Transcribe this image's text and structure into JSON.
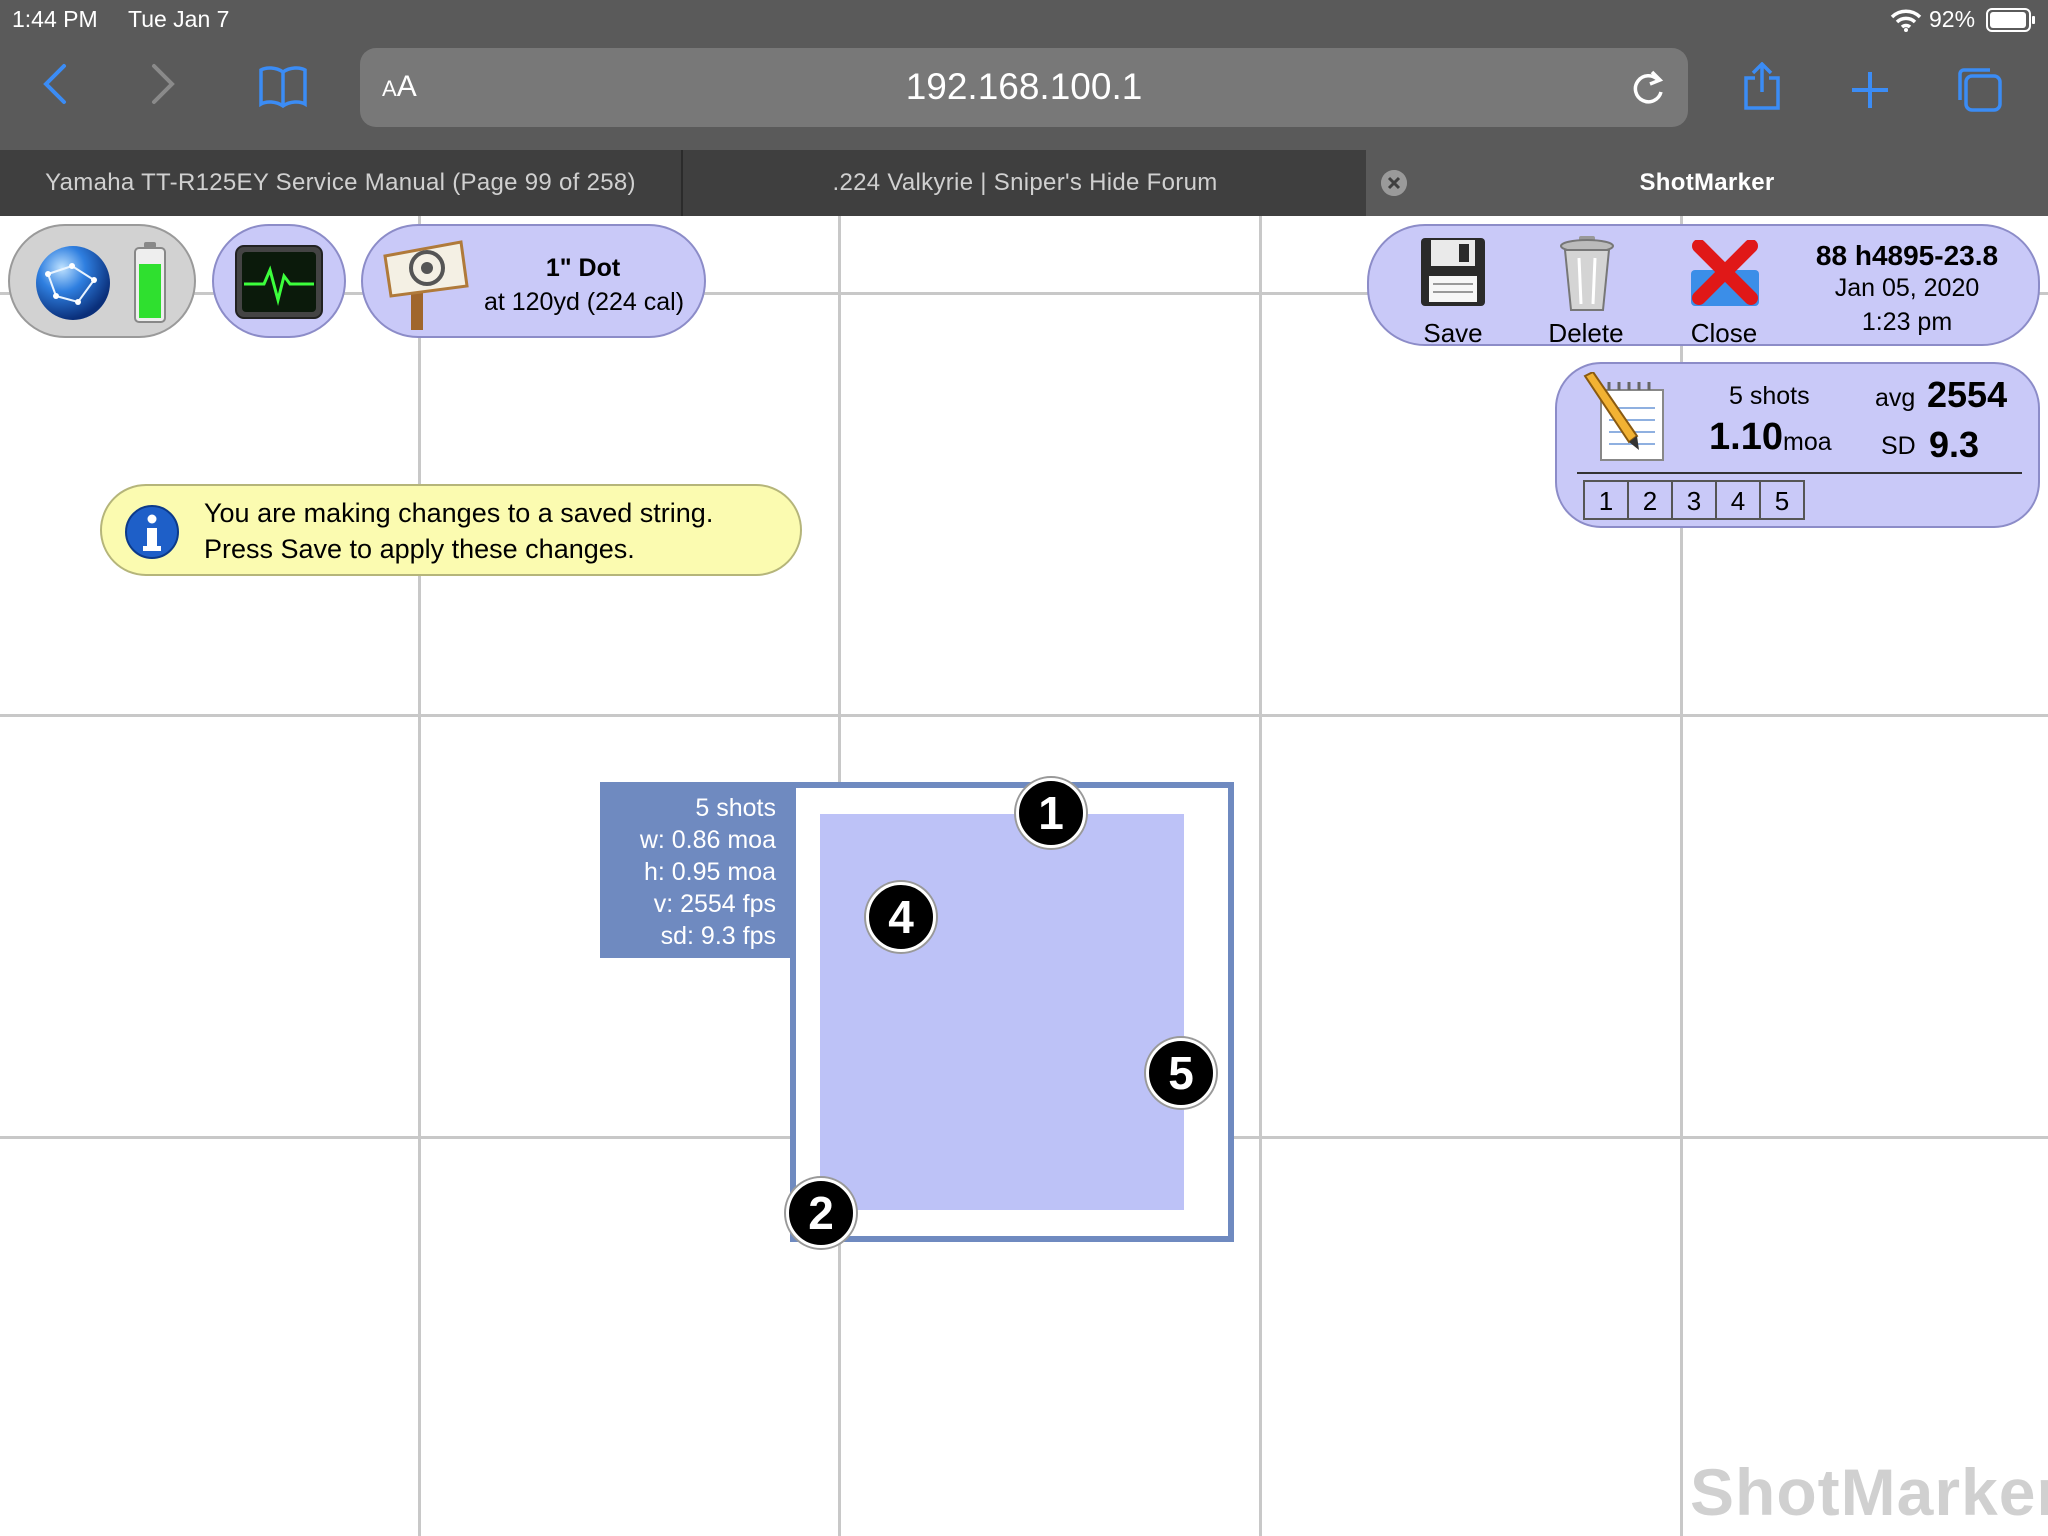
{
  "status_bar": {
    "time": "1:44 PM",
    "date": "Tue Jan 7",
    "battery": "92%"
  },
  "browser": {
    "url": "192.168.100.1",
    "text_size_label": "AA"
  },
  "tabs": [
    {
      "label": "Yamaha TT-R125EY Service Manual (Page 99 of 258)"
    },
    {
      "label": ".224 Valkyrie | Sniper's Hide Forum"
    },
    {
      "label": "ShotMarker",
      "active": true
    }
  ],
  "target_info": {
    "name": "1\" Dot",
    "distance": "at 120yd (224 cal)"
  },
  "actions": {
    "save": "Save",
    "delete": "Delete",
    "close": "Close"
  },
  "string": {
    "title": "88 h4895-23.8",
    "date": "Jan 05, 2020",
    "time": "1:23 pm"
  },
  "stats": {
    "shots": "5 shots",
    "moa": "1.10",
    "moa_unit": "moa",
    "avg_label": "avg",
    "avg": "2554",
    "sd_label": "SD",
    "sd": "9.3",
    "shot_buttons": [
      "1",
      "2",
      "3",
      "4",
      "5"
    ]
  },
  "notice": {
    "line1": "You are making changes to a saved string.",
    "line2": "Press Save to apply these changes."
  },
  "group": {
    "shots": "5 shots",
    "w": "w: 0.86 moa",
    "h": "h: 0.95 moa",
    "v": "v: 2554 fps",
    "sd": "sd: 9.3 fps"
  },
  "shots_on_target": [
    {
      "label": "1"
    },
    {
      "label": "4"
    },
    {
      "label": "5"
    },
    {
      "label": "2"
    }
  ],
  "watermark": "ShotMarker",
  "colors": {
    "pill_fill": "#c9c9f8",
    "group_outline": "#6f8ac0",
    "group_fill": "#bdc2f7",
    "notice": "#fbfbb0"
  }
}
